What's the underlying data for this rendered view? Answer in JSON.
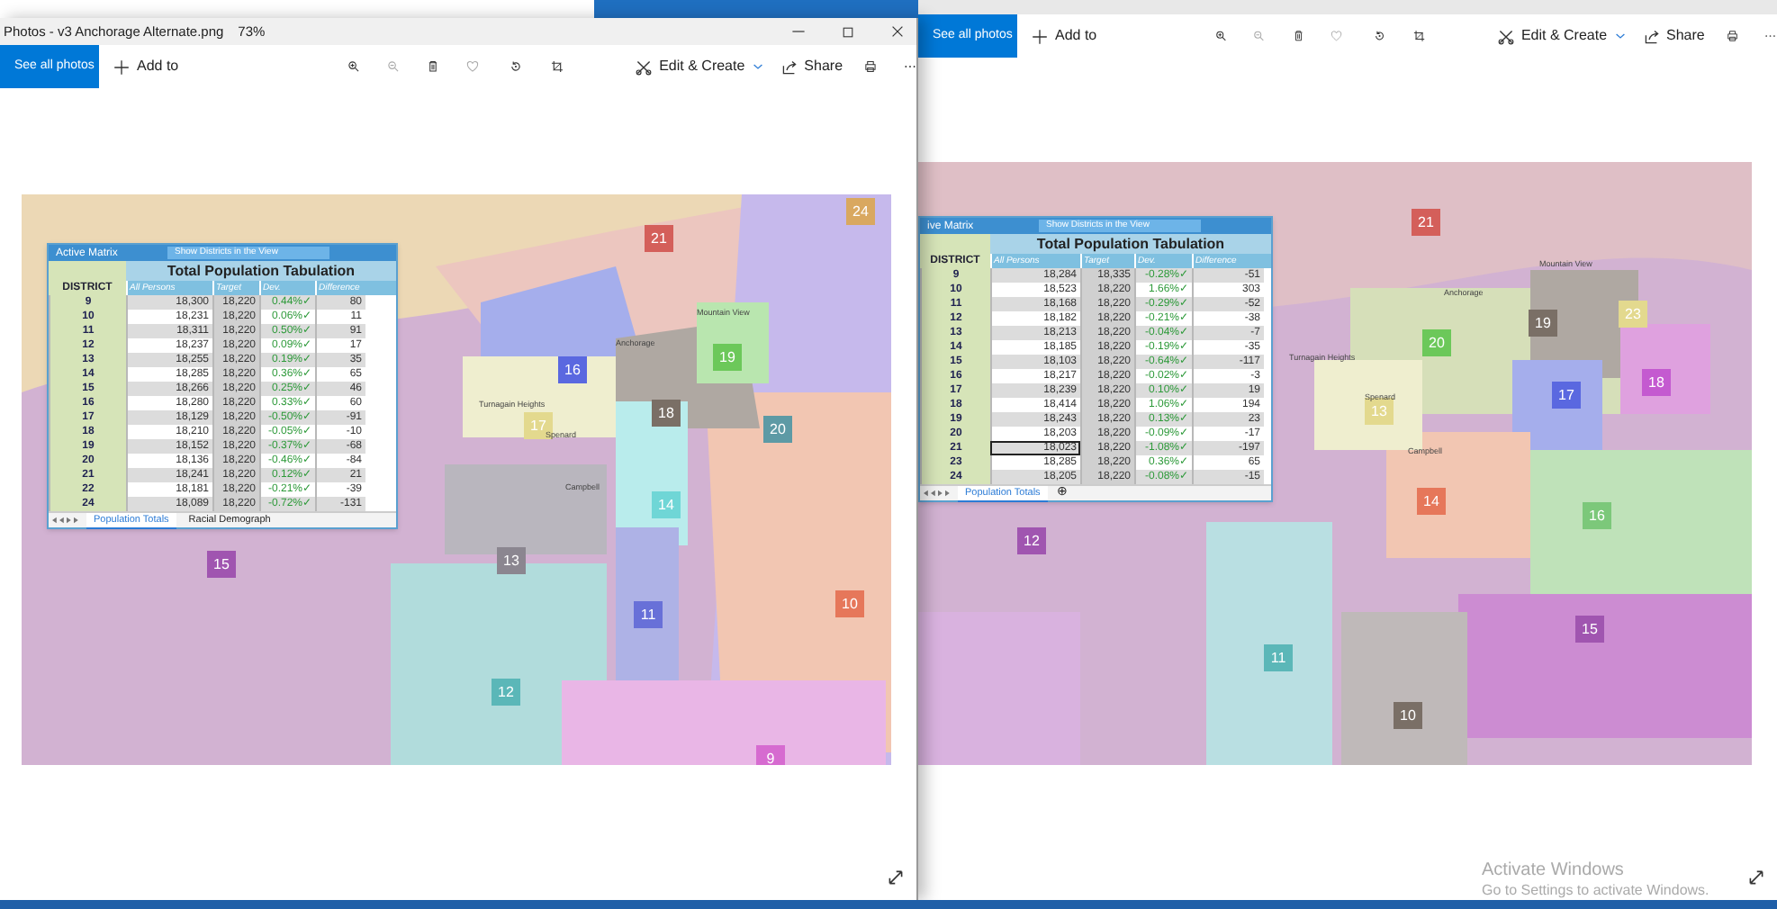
{
  "windows": [
    {
      "title": "Photos - v3 Anchorage Alternate.png",
      "zoom": "73%",
      "toolbar": {
        "see_all": "See all photos",
        "add_to": "Add to",
        "edit_create": "Edit & Create",
        "share": "Share"
      },
      "matrix": {
        "title": "Active Matrix",
        "view_dropdown": "Show Districts in the View",
        "heading": "Total Population Tabulation",
        "columns": [
          "DISTRICT",
          "All Persons",
          "Target",
          "Dev.",
          "Difference"
        ],
        "rows": [
          {
            "cells": [
              "9",
              "18,300",
              "18,220",
              "0.44%✓",
              "80"
            ],
            "selected": false
          },
          {
            "cells": [
              "10",
              "18,231",
              "18,220",
              "0.06%✓",
              "11"
            ],
            "selected": false
          },
          {
            "cells": [
              "11",
              "18,311",
              "18,220",
              "0.50%✓",
              "91"
            ],
            "selected": false
          },
          {
            "cells": [
              "12",
              "18,237",
              "18,220",
              "0.09%✓",
              "17"
            ],
            "selected": false
          },
          {
            "cells": [
              "13",
              "18,255",
              "18,220",
              "0.19%✓",
              "35"
            ],
            "selected": false
          },
          {
            "cells": [
              "14",
              "18,285",
              "18,220",
              "0.36%✓",
              "65"
            ],
            "selected": false
          },
          {
            "cells": [
              "15",
              "18,266",
              "18,220",
              "0.25%✓",
              "46"
            ],
            "selected": false
          },
          {
            "cells": [
              "16",
              "18,280",
              "18,220",
              "0.33%✓",
              "60"
            ],
            "selected": false
          },
          {
            "cells": [
              "17",
              "18,129",
              "18,220",
              "-0.50%✓",
              "-91"
            ],
            "selected": false
          },
          {
            "cells": [
              "18",
              "18,210",
              "18,220",
              "-0.05%✓",
              "-10"
            ],
            "selected": false
          },
          {
            "cells": [
              "19",
              "18,152",
              "18,220",
              "-0.37%✓",
              "-68"
            ],
            "selected": false
          },
          {
            "cells": [
              "20",
              "18,136",
              "18,220",
              "-0.46%✓",
              "-84"
            ],
            "selected": false
          },
          {
            "cells": [
              "21",
              "18,241",
              "18,220",
              "0.12%✓",
              "21"
            ],
            "selected": false
          },
          {
            "cells": [
              "22",
              "18,181",
              "18,220",
              "-0.21%✓",
              "-39"
            ],
            "selected": false
          },
          {
            "cells": [
              "24",
              "18,089",
              "18,220",
              "-0.72%✓",
              "-131"
            ],
            "selected": false
          }
        ],
        "tabs": [
          {
            "label": "Population Totals",
            "kind": "sheet",
            "selected": true
          },
          {
            "label": "Racial Demograph",
            "kind": "sheet",
            "selected": false
          }
        ]
      },
      "districts": [
        {
          "label": "24",
          "color": "#d9a860"
        },
        {
          "label": "21",
          "color": "#d45f5a"
        },
        {
          "label": "16",
          "color": "#5a68e0"
        },
        {
          "label": "19",
          "color": "#6cc85a"
        },
        {
          "label": "18",
          "color": "#7a6f66"
        },
        {
          "label": "20",
          "color": "#5d9aa5"
        },
        {
          "label": "17",
          "color": "#e3d98e"
        },
        {
          "label": "14",
          "color": "#6fd6d6"
        },
        {
          "label": "15",
          "color": "#a055b0"
        },
        {
          "label": "13",
          "color": "#8b8690"
        },
        {
          "label": "11",
          "color": "#6870d8"
        },
        {
          "label": "10",
          "color": "#e6775a"
        },
        {
          "label": "12",
          "color": "#5bb7b8"
        },
        {
          "label": "9",
          "color": "#d66bd0"
        }
      ],
      "places": [
        "Mountain View",
        "Anchorage",
        "Turnagain Heights",
        "Spenard",
        "Campbell"
      ]
    },
    {
      "toolbar": {
        "see_all": "See all photos",
        "add_to": "Add to",
        "edit_create": "Edit & Create",
        "share": "Share"
      },
      "matrix": {
        "title": "ive Matrix",
        "view_dropdown": "Show Districts in the View",
        "heading": "Total Population Tabulation",
        "columns": [
          "DISTRICT",
          "All Persons",
          "Target",
          "Dev.",
          "Difference"
        ],
        "rows": [
          {
            "cells": [
              "9",
              "18,284",
              "18,335",
              "-0.28%✓",
              "-51"
            ],
            "selected": false
          },
          {
            "cells": [
              "10",
              "18,523",
              "18,220",
              "1.66%✓",
              "303"
            ],
            "selected": false
          },
          {
            "cells": [
              "11",
              "18,168",
              "18,220",
              "-0.29%✓",
              "-52"
            ],
            "selected": false
          },
          {
            "cells": [
              "12",
              "18,182",
              "18,220",
              "-0.21%✓",
              "-38"
            ],
            "selected": false
          },
          {
            "cells": [
              "13",
              "18,213",
              "18,220",
              "-0.04%✓",
              "-7"
            ],
            "selected": false
          },
          {
            "cells": [
              "14",
              "18,185",
              "18,220",
              "-0.19%✓",
              "-35"
            ],
            "selected": false
          },
          {
            "cells": [
              "15",
              "18,103",
              "18,220",
              "-0.64%✓",
              "-117"
            ],
            "selected": false
          },
          {
            "cells": [
              "16",
              "18,217",
              "18,220",
              "-0.02%✓",
              "-3"
            ],
            "selected": false
          },
          {
            "cells": [
              "17",
              "18,239",
              "18,220",
              "0.10%✓",
              "19"
            ],
            "selected": false
          },
          {
            "cells": [
              "18",
              "18,414",
              "18,220",
              "1.06%✓",
              "194"
            ],
            "selected": false
          },
          {
            "cells": [
              "19",
              "18,243",
              "18,220",
              "0.13%✓",
              "23"
            ],
            "selected": false
          },
          {
            "cells": [
              "20",
              "18,203",
              "18,220",
              "-0.09%✓",
              "-17"
            ],
            "selected": false
          },
          {
            "cells": [
              "21",
              "18,023",
              "18,220",
              "-1.08%✓",
              "-197"
            ],
            "selected": true
          },
          {
            "cells": [
              "23",
              "18,285",
              "18,220",
              "0.36%✓",
              "65"
            ],
            "selected": false
          },
          {
            "cells": [
              "24",
              "18,205",
              "18,220",
              "-0.08%✓",
              "-15"
            ],
            "selected": false
          }
        ],
        "tabs": [
          {
            "label": "Population Totals",
            "kind": "sheet",
            "selected": true
          },
          {
            "label": "⊕",
            "kind": "add",
            "selected": false
          }
        ]
      },
      "districts": [
        {
          "label": "21",
          "color": "#d45f5a"
        },
        {
          "label": "19",
          "color": "#7a6f66"
        },
        {
          "label": "23",
          "color": "#e3d98e"
        },
        {
          "label": "20",
          "color": "#6cc85a"
        },
        {
          "label": "18",
          "color": "#c45ad0"
        },
        {
          "label": "13",
          "color": "#e3d98e"
        },
        {
          "label": "17",
          "color": "#5a68e0"
        },
        {
          "label": "14",
          "color": "#e6775a"
        },
        {
          "label": "16",
          "color": "#7cc87a"
        },
        {
          "label": "12",
          "color": "#a055b0"
        },
        {
          "label": "15",
          "color": "#a055b0"
        },
        {
          "label": "11",
          "color": "#5bb7b8"
        },
        {
          "label": "10",
          "color": "#7a6f66"
        }
      ],
      "places": [
        "Mountain View",
        "Anchorage",
        "Turnagain Heights",
        "Spenard",
        "Campbell"
      ]
    }
  ],
  "watermark": {
    "title": "Activate Windows",
    "subtitle": "Go to Settings to activate Windows."
  }
}
